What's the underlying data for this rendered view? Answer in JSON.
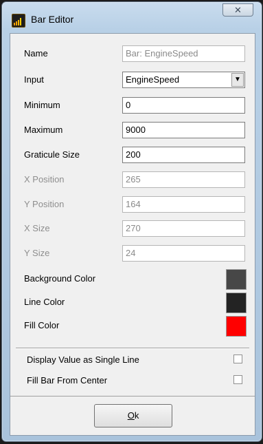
{
  "window": {
    "title": "Bar Editor",
    "close_glyph": "✕",
    "icon": "bar-chart-app-icon"
  },
  "fields": [
    {
      "label": "Name",
      "value": "Bar: EngineSpeed",
      "enabled": false
    },
    {
      "label": "Input",
      "value": "EngineSpeed",
      "type": "select"
    },
    {
      "label": "Minimum",
      "value": "0",
      "enabled": true
    },
    {
      "label": "Maximum",
      "value": "9000",
      "enabled": true
    },
    {
      "label": "Graticule Size",
      "value": "200",
      "enabled": true
    },
    {
      "label": "X Position",
      "value": "265",
      "enabled": false
    },
    {
      "label": "Y Position",
      "value": "164",
      "enabled": false
    },
    {
      "label": "X Size",
      "value": "270",
      "enabled": false
    },
    {
      "label": "Y Size",
      "value": "24",
      "enabled": false
    }
  ],
  "colors": [
    {
      "label": "Background Color",
      "color": "#474747"
    },
    {
      "label": "Line Color",
      "color": "#232323"
    },
    {
      "label": "Fill Color",
      "color": "#ff0000"
    }
  ],
  "options": [
    {
      "label": "Display Value as Single Line",
      "checked": false
    },
    {
      "label": "Fill Bar From Center",
      "checked": false
    }
  ],
  "buttons": {
    "ok_mnemonic": "O",
    "ok_rest": "k"
  },
  "dropdown_glyph": "▼"
}
